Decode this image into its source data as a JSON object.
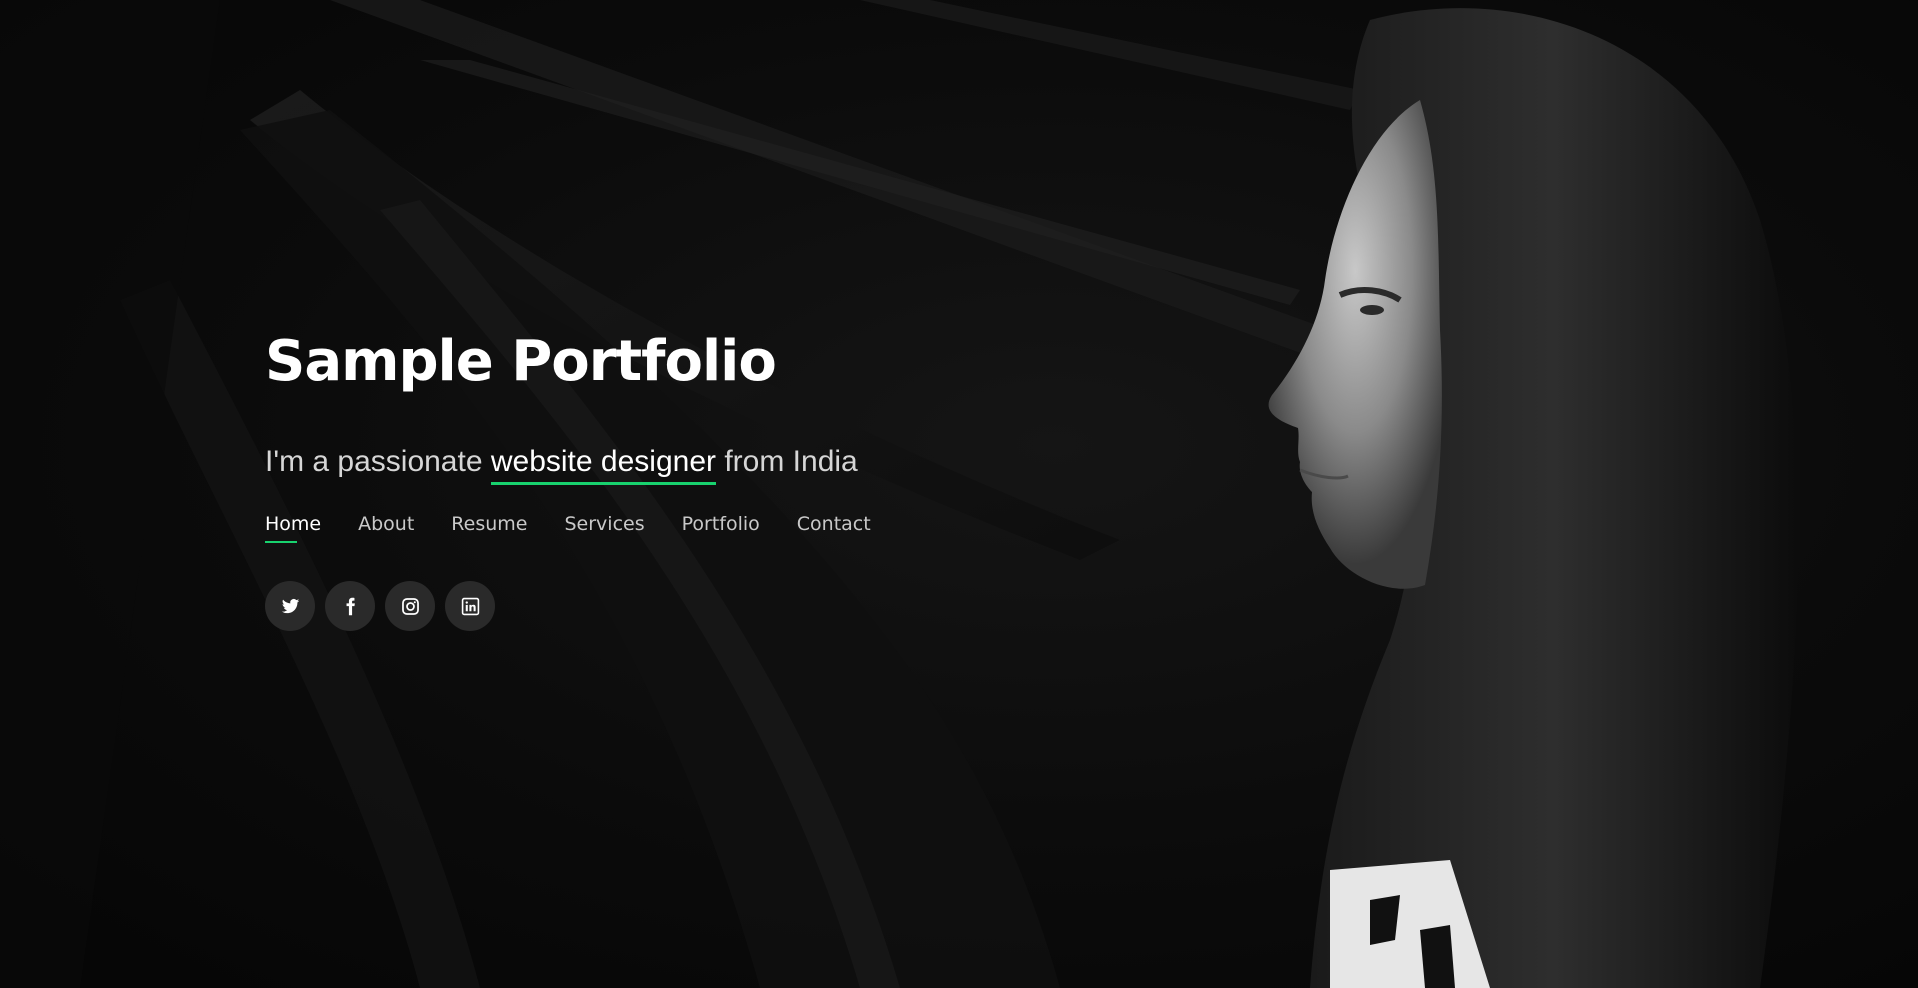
{
  "hero": {
    "title": "Sample Portfolio",
    "tagline_prefix": "I'm a passionate",
    "tagline_highlight": "website designer",
    "tagline_suffix": "from India",
    "accent_color": "#18d26e",
    "background_image": "black-and-white-profile-portrait-of-woman"
  },
  "nav": {
    "items": [
      {
        "label": "Home",
        "active": true
      },
      {
        "label": "About",
        "active": false
      },
      {
        "label": "Resume",
        "active": false
      },
      {
        "label": "Services",
        "active": false
      },
      {
        "label": "Portfolio",
        "active": false
      },
      {
        "label": "Contact",
        "active": false
      }
    ]
  },
  "social": {
    "icons": [
      "twitter-icon",
      "facebook-icon",
      "instagram-icon",
      "linkedin-icon"
    ]
  }
}
